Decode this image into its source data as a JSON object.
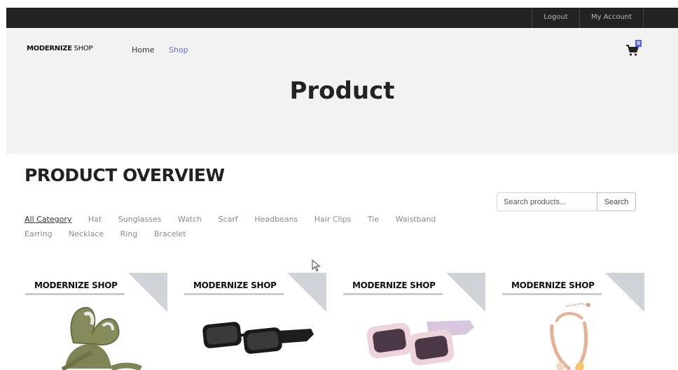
{
  "topbar": {
    "logout": "Logout",
    "account": "My Account"
  },
  "header": {
    "logo_bold": "MODERNIZE",
    "logo_rest": " SHOP",
    "nav": {
      "home": "Home",
      "shop": "Shop"
    },
    "cart_count": "0",
    "hero_title": "Product"
  },
  "overview": {
    "title": "PRODUCT OVERVIEW",
    "search_placeholder": "Search products...",
    "search_button": "Search",
    "categories": [
      "All Category",
      "Hat",
      "Sunglasses",
      "Watch",
      "Scarf",
      "Headbeans",
      "Hair Clips",
      "Tie",
      "Waistband",
      "Earring",
      "Necklace",
      "Ring",
      "Bracelet"
    ]
  },
  "products": [
    {
      "brand": "MODERNIZE SHOP",
      "image": "hair-clip-image"
    },
    {
      "brand": "MODERNIZE SHOP",
      "image": "black-sunglasses-image"
    },
    {
      "brand": "MODERNIZE SHOP",
      "image": "pink-sunglasses-image"
    },
    {
      "brand": "MODERNIZE SHOP",
      "image": "bracelet-image"
    }
  ],
  "colors": {
    "topbar": "#222222",
    "hero": "#f2f2f2",
    "accent": "#6a6fd6",
    "badge": "#5b5ff0"
  }
}
